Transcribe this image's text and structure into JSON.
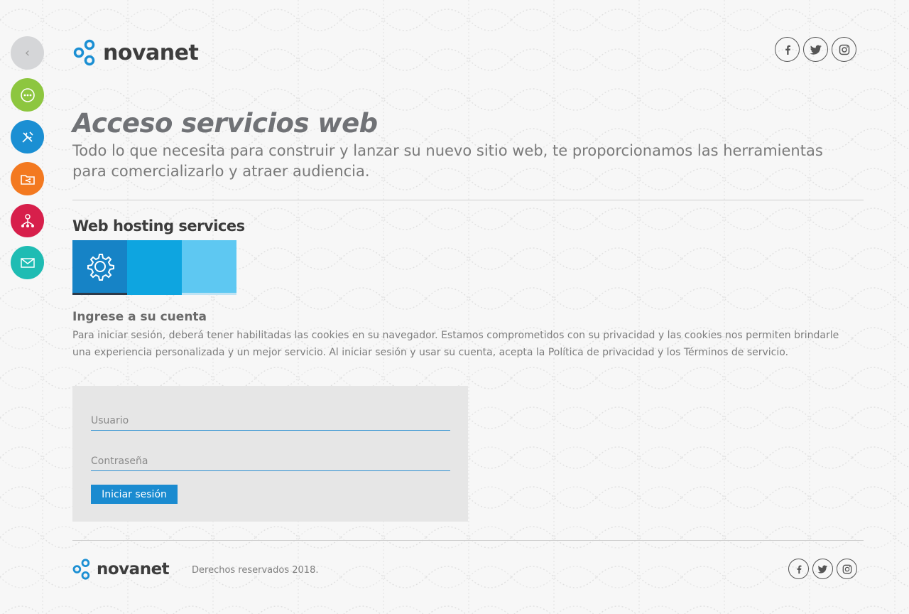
{
  "brand": {
    "name": "novanet"
  },
  "side_nav": [
    {
      "name": "back-button",
      "icon": "chevron-left-icon",
      "color": "#d5d6d8",
      "glyph": "‹"
    },
    {
      "name": "chat-button",
      "icon": "chat-icon",
      "color": "#8dc63f"
    },
    {
      "name": "tools-button",
      "icon": "tools-icon",
      "color": "#1b8fd3"
    },
    {
      "name": "folder-share-button",
      "icon": "folder-share-icon",
      "color": "#f37920"
    },
    {
      "name": "network-button",
      "icon": "network-people-icon",
      "color": "#d71f4b"
    },
    {
      "name": "mail-button",
      "icon": "envelope-icon",
      "color": "#1fbcb3"
    }
  ],
  "social": [
    {
      "name": "facebook",
      "icon": "facebook-icon"
    },
    {
      "name": "twitter",
      "icon": "twitter-icon"
    },
    {
      "name": "instagram",
      "icon": "instagram-icon"
    }
  ],
  "header": {
    "title": "Acceso servicios web",
    "subtitle": "Todo lo que necesita para construir y lanzar su nuevo sitio web, te proporcionamos las herramientas para comercializarlo y atraer audiencia."
  },
  "section": {
    "title": "Web hosting services",
    "tiles": [
      {
        "name": "settings-tile",
        "icon": "gear-icon",
        "color": "#1683c6"
      },
      {
        "name": "tile-2",
        "icon": "",
        "color": "#0ea5e0"
      },
      {
        "name": "tile-3",
        "icon": "",
        "color": "#5ec8f2"
      }
    ]
  },
  "login": {
    "title": "Ingrese a su cuenta",
    "description": "Para iniciar sesión, deberá tener habilitadas las cookies en su navegador. Estamos comprometidos con su privacidad y las cookies nos permiten brindarle una experiencia personalizada y un mejor servicio. Al iniciar sesión y usar su cuenta, acepta la Política de privacidad y los Términos de servicio.",
    "username_placeholder": "Usuario",
    "username_value": "",
    "password_placeholder": "Contraseña",
    "password_value": "",
    "submit_label": "Iniciar sesión"
  },
  "footer": {
    "copyright": "Derechos reservados 2018."
  },
  "colors": {
    "accent": "#1a8bd0",
    "text_gray": "#777777",
    "background": "#f7f7f7",
    "login_box": "#e6e6e6"
  }
}
